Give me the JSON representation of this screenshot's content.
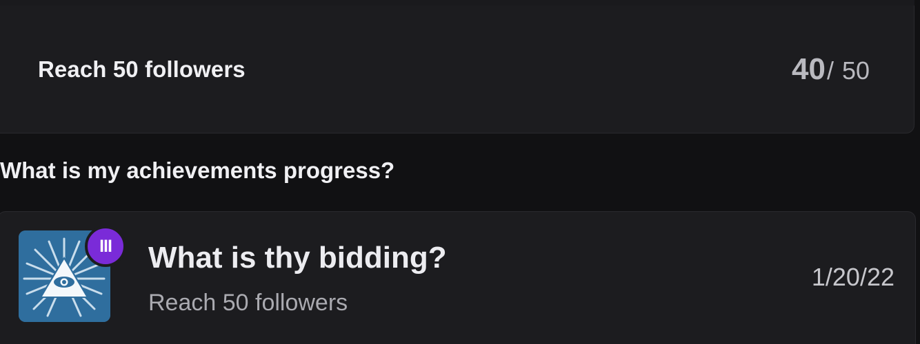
{
  "progress_card": {
    "title": "Reach 50 followers",
    "current": "40",
    "separator": "/",
    "target": "50"
  },
  "section": {
    "heading": "What is my achievements progress?"
  },
  "achievement": {
    "title": "What is thy bidding?",
    "description": "Reach 50 followers",
    "date": "1/20/22",
    "tier": "III",
    "icon": "eye-pyramid-icon",
    "colors": {
      "badge_background": "#2f6e9e",
      "tier_background": "#7a2bd8"
    }
  }
}
